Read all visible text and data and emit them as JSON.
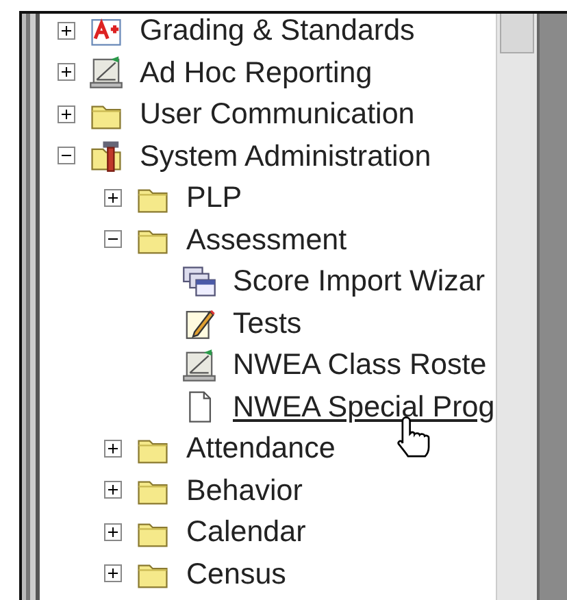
{
  "tree": [
    {
      "label": "Grading & Standards",
      "kind": "grades",
      "expanded": false,
      "hovered": false
    },
    {
      "label": "Ad Hoc Reporting",
      "kind": "report",
      "expanded": false,
      "hovered": false
    },
    {
      "label": "User Communication",
      "kind": "folder",
      "expanded": false,
      "hovered": false
    },
    {
      "label": "System Administration",
      "kind": "tools",
      "expanded": true,
      "hovered": false,
      "children": [
        {
          "label": "PLP",
          "kind": "folder",
          "expanded": false,
          "hovered": false
        },
        {
          "label": "Assessment",
          "kind": "folder",
          "expanded": true,
          "hovered": false,
          "children": [
            {
              "label": "Score Import Wizar",
              "kind": "wizard",
              "hovered": false
            },
            {
              "label": "Tests",
              "kind": "test",
              "hovered": false
            },
            {
              "label": "NWEA Class Roste",
              "kind": "report",
              "hovered": false
            },
            {
              "label": "NWEA Special Prog",
              "kind": "document",
              "hovered": true
            }
          ]
        },
        {
          "label": "Attendance",
          "kind": "folder",
          "expanded": false,
          "hovered": false
        },
        {
          "label": "Behavior",
          "kind": "folder",
          "expanded": false,
          "hovered": false
        },
        {
          "label": "Calendar",
          "kind": "folder",
          "expanded": false,
          "hovered": false
        },
        {
          "label": "Census",
          "kind": "folder",
          "expanded": false,
          "hovered": false
        }
      ]
    }
  ]
}
